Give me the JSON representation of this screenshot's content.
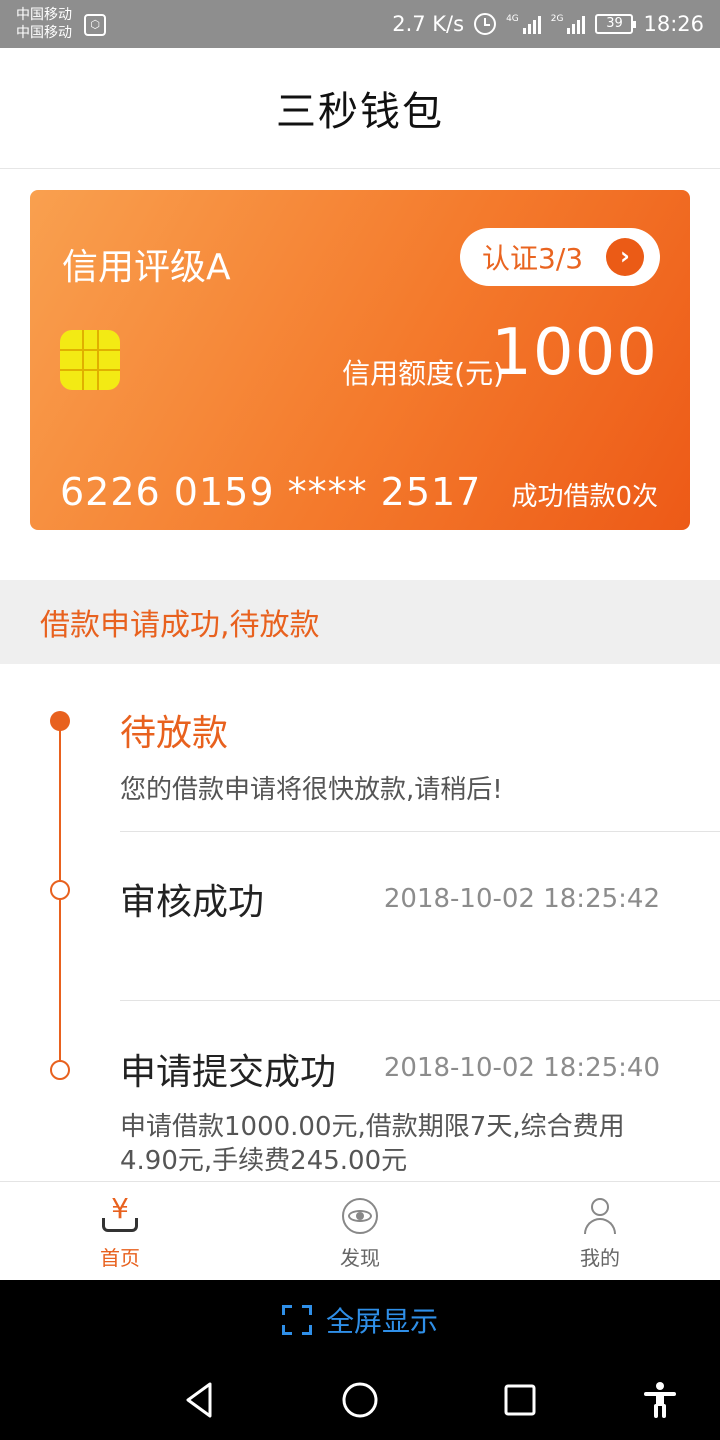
{
  "status_bar": {
    "carrier_1": "中国移动",
    "carrier_2": "中国移动",
    "speed": "2.7 K/s",
    "network_1": "4G",
    "network_2": "2G",
    "battery": "39",
    "time": "18:26"
  },
  "header": {
    "title": "三秒钱包"
  },
  "card": {
    "credit_grade": "信用评级A",
    "auth_label": "认证3/3",
    "limit_label": "信用额度(元)",
    "limit_value": "1000",
    "card_number": "6226 0159 **** 2517",
    "borrow_count": "成功借款0次"
  },
  "banner": {
    "status_text": "借款申请成功,待放款"
  },
  "timeline": {
    "steps": [
      {
        "title": "待放款",
        "time": "",
        "desc": "您的借款申请将很快放款,请稍后!"
      },
      {
        "title": "审核成功",
        "time": "2018-10-02 18:25:42",
        "desc": ""
      },
      {
        "title": "申请提交成功",
        "time": "2018-10-02 18:25:40",
        "desc_line1": "申请借款1000.00元,借款期限7天,综合费用",
        "desc_line2": "4.90元,手续费245.00元"
      }
    ]
  },
  "bottom_nav": {
    "items": [
      {
        "label": "首页",
        "icon": "yen-tray-icon",
        "active": true
      },
      {
        "label": "发现",
        "icon": "eye-icon",
        "active": false
      },
      {
        "label": "我的",
        "icon": "user-icon",
        "active": false
      }
    ]
  },
  "fullscreen": {
    "label": "全屏显示"
  },
  "colors": {
    "accent": "#e8611e",
    "card_gradient_start": "#f9a04f",
    "card_gradient_end": "#ed5a17",
    "chip": "#f3ea14",
    "fullscreen_text": "#2f8fe8"
  }
}
